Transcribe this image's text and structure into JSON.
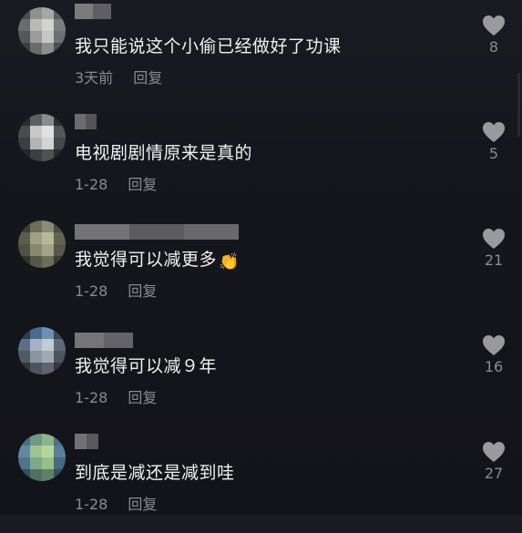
{
  "comments": [
    {
      "text": "我只能说这个小偷已经做好了功课",
      "time": "3天前",
      "reply": "回复",
      "likes": "8"
    },
    {
      "text": "电视剧剧情原来是真的",
      "time": "1-28",
      "reply": "回复",
      "likes": "5"
    },
    {
      "text": "我觉得可以减更多",
      "emoji": "👏",
      "time": "1-28",
      "reply": "回复",
      "likes": "21"
    },
    {
      "text": "我觉得可以减９年",
      "time": "1-28",
      "reply": "回复",
      "likes": "16"
    },
    {
      "text": "到底是减还是减到哇",
      "time": "1-28",
      "reply": "回复",
      "likes": "27"
    }
  ],
  "icons": {
    "like": "heart-icon"
  },
  "colors": {
    "background": "#15161c",
    "text": "#f2f2f2",
    "meta": "#8a8b90",
    "heart": "#9a9a9e"
  }
}
